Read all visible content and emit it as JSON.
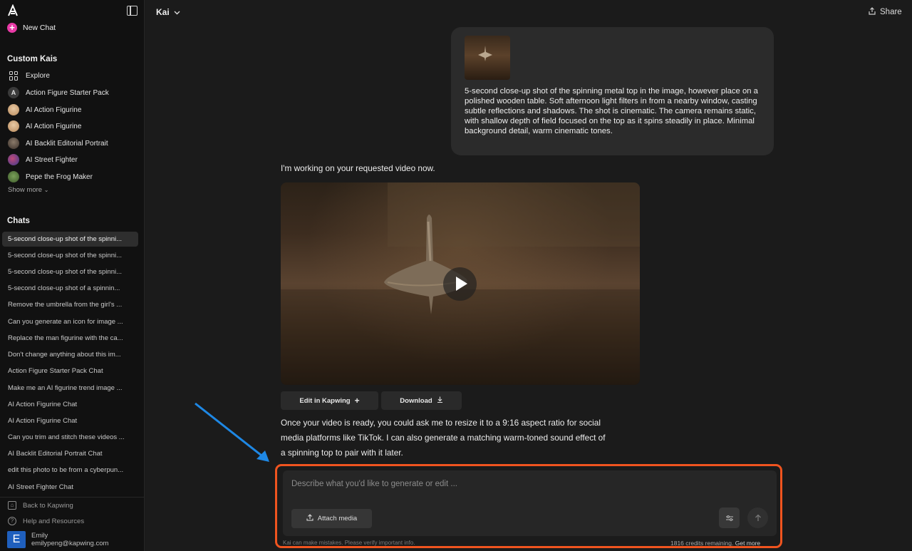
{
  "sidebar": {
    "new_chat": "New Chat",
    "custom_kais_title": "Custom Kais",
    "kais": [
      {
        "label": "Explore",
        "icon": "explore-grid-icon"
      },
      {
        "label": "Action Figure Starter Pack",
        "avatar": "A"
      },
      {
        "label": "AI Action Figurine"
      },
      {
        "label": "AI Action Figurine"
      },
      {
        "label": "AI Backlit Editorial Portrait"
      },
      {
        "label": "AI Street Fighter"
      },
      {
        "label": "Pepe the Frog Maker"
      }
    ],
    "show_more": "Show more",
    "chats_title": "Chats",
    "chats": [
      "5-second close-up shot of the spinni...",
      "5-second close-up shot of the spinni...",
      "5-second close-up shot of the spinni...",
      "5-second close-up shot of a spinnin...",
      "Remove the umbrella from the girl's ...",
      "Can you generate an icon for image ...",
      "Replace the man figurine with the ca...",
      "Don't change anything about this im...",
      "Action Figure Starter Pack Chat",
      "Make me an AI figurine trend image ...",
      "AI Action Figurine Chat",
      "AI Action Figurine Chat",
      "Can you trim and stitch these videos ...",
      "AI Backlit Editorial Portrait Chat",
      "edit this photo to be from a cyberpun...",
      "AI Street Fighter Chat"
    ],
    "footer": {
      "back": "Back to Kapwing",
      "help": "Help and Resources"
    },
    "user": {
      "initial": "E",
      "name": "Emily",
      "email": "emilypeng@kapwing.com"
    }
  },
  "header": {
    "kai_selector": "Kai",
    "share": "Share"
  },
  "conversation": {
    "user_prompt": "5-second close-up shot of the spinning metal top in the image, however place on a polished wooden table. Soft afternoon light filters in from a nearby window, casting subtle reflections and shadows. The shot is cinematic. The camera remains static, with shallow depth of field focused on the top as it spins steadily in place. Minimal background detail, warm cinematic tones.",
    "assistant_intro": "I'm working on your requested video now.",
    "edit_button": "Edit in Kapwing",
    "download_button": "Download",
    "assistant_followup": "Once your video is ready, you could ask me to resize it to a 9:16 aspect ratio for social media platforms like TikTok. I can also generate a matching warm-toned sound effect of a spinning top to pair with it later."
  },
  "composer": {
    "placeholder": "Describe what you'd like to generate or edit ...",
    "attach_media": "Attach media",
    "disclaimer": "Kai can make mistakes. Please verify important info.",
    "credits": "1816 credits remaining.",
    "get_more": "Get more"
  },
  "colors": {
    "highlight": "#f0541f",
    "arrow": "#1e88e5",
    "new_chat_accent": "#e83aa6"
  }
}
